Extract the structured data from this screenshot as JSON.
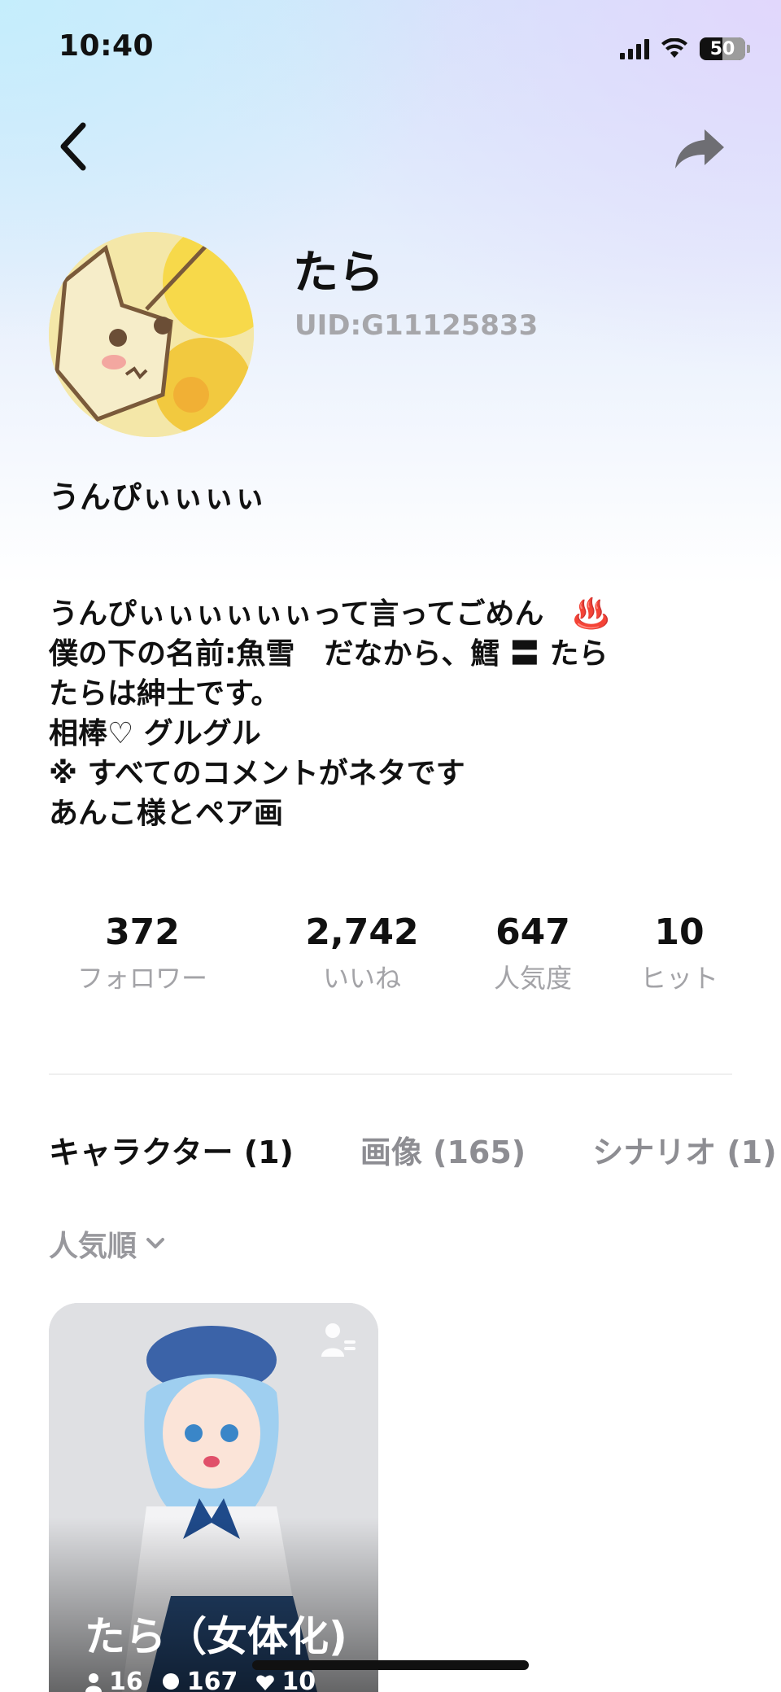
{
  "status_bar": {
    "time": "10:40",
    "battery": "50",
    "battery_level": 0.5
  },
  "header": {
    "back_icon": "chevron-left-icon",
    "share_icon": "share-arrow-icon"
  },
  "profile": {
    "name": "たら",
    "uid": "UID:G11125833",
    "avatar_desc": "mimikyu-avatar",
    "short_bio": "うんぴぃぃぃぃ",
    "bio_lines": [
      "うんぴぃぃぃぃぃぃって言ってごめん　♨️",
      "僕の下の名前:魚雪　だなから、鱈 〓 たら",
      "たらは紳士です。",
      "相棒♡ グルグル",
      "※ すべてのコメントがネタです",
      "あんこ様とペア画"
    ]
  },
  "stats": [
    {
      "value": "372",
      "label": "フォロワー"
    },
    {
      "value": "2,742",
      "label": "いいね"
    },
    {
      "value": "647",
      "label": "人気度"
    },
    {
      "value": "10",
      "label": "ヒット"
    }
  ],
  "tabs": [
    {
      "label": "キャラクター (1)",
      "active": true
    },
    {
      "label": "画像 (165)",
      "active": false
    },
    {
      "label": "シナリオ (1)",
      "active": false
    }
  ],
  "sort": {
    "label": "人気順",
    "icon": "chevron-down-icon"
  },
  "character_card": {
    "title": "たら（女体化)",
    "stats": [
      {
        "icon": "person-icon",
        "value": "16"
      },
      {
        "icon": "chat-icon",
        "value": "167"
      },
      {
        "icon": "heart-icon",
        "value": "10"
      }
    ]
  },
  "colors": {
    "accent_text": "#111111",
    "muted_text": "#a3a3a7"
  }
}
